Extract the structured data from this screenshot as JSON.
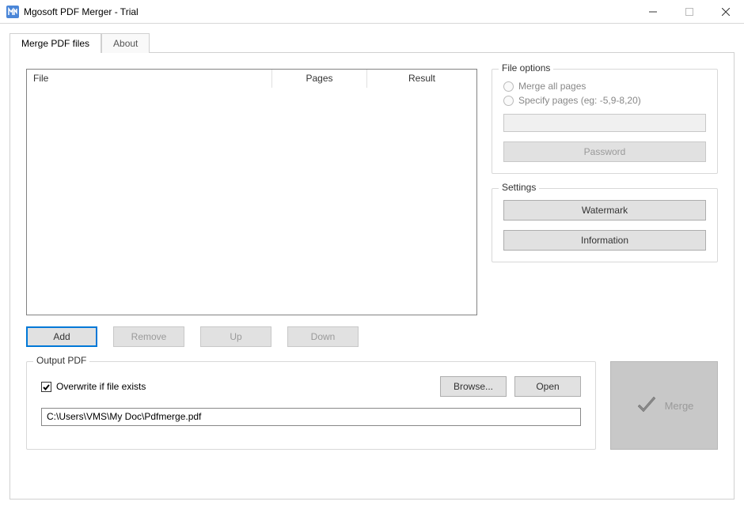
{
  "window": {
    "title": "Mgosoft PDF Merger - Trial"
  },
  "tabs": {
    "merge": "Merge PDF files",
    "about": "About"
  },
  "table": {
    "headers": {
      "file": "File",
      "pages": "Pages",
      "result": "Result"
    }
  },
  "fileOptions": {
    "legend": "File options",
    "mergeAll": "Merge all pages",
    "specify": "Specify pages (eg: -5,9-8,20)",
    "password": "Password"
  },
  "settings": {
    "legend": "Settings",
    "watermark": "Watermark",
    "information": "Information"
  },
  "actions": {
    "add": "Add",
    "remove": "Remove",
    "up": "Up",
    "down": "Down"
  },
  "output": {
    "legend": "Output PDF",
    "overwrite": "Overwrite if file exists",
    "browse": "Browse...",
    "open": "Open",
    "path": "C:\\Users\\VMS\\My Doc\\Pdfmerge.pdf"
  },
  "merge": {
    "label": "Merge"
  }
}
